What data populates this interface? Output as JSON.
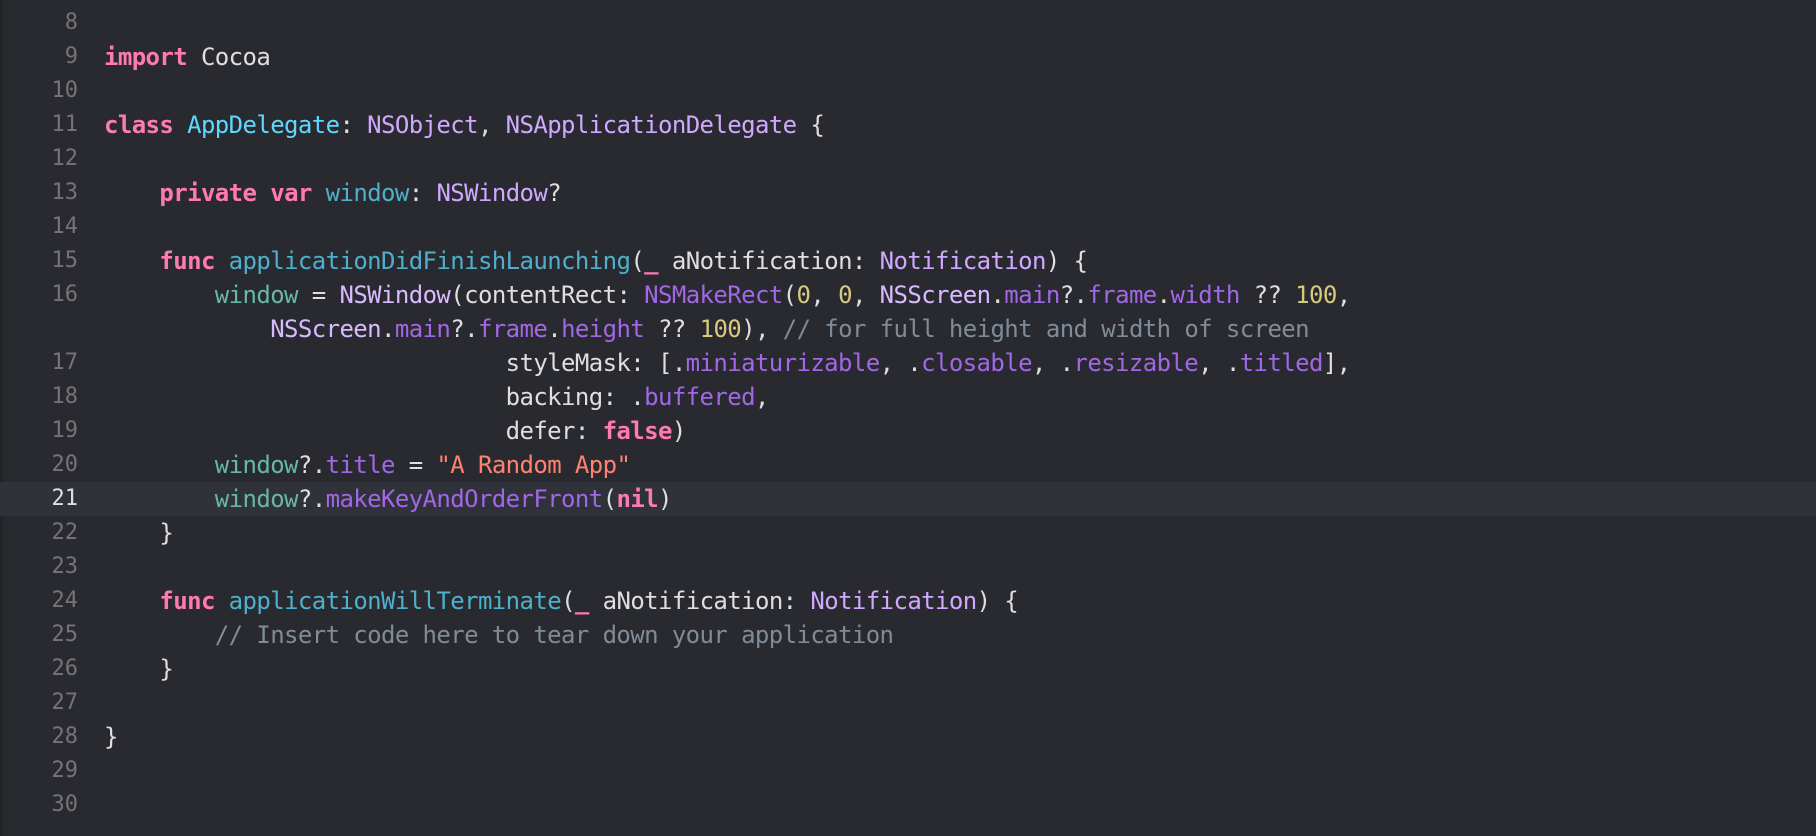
{
  "editor": {
    "lines": [
      {
        "number": "8",
        "current": false,
        "segments": []
      },
      {
        "number": "9",
        "current": false,
        "segments": [
          {
            "t": "import",
            "c": "kw"
          },
          {
            "t": " Cocoa",
            "c": "plain"
          }
        ]
      },
      {
        "number": "10",
        "current": false,
        "segments": []
      },
      {
        "number": "11",
        "current": false,
        "segments": [
          {
            "t": "class",
            "c": "kw"
          },
          {
            "t": " ",
            "c": "plain"
          },
          {
            "t": "AppDelegate",
            "c": "typeDecl"
          },
          {
            "t": ": ",
            "c": "plain"
          },
          {
            "t": "NSObject",
            "c": "type"
          },
          {
            "t": ", ",
            "c": "plain"
          },
          {
            "t": "NSApplicationDelegate",
            "c": "type"
          },
          {
            "t": " {",
            "c": "plain"
          }
        ]
      },
      {
        "number": "12",
        "current": false,
        "segments": []
      },
      {
        "number": "13",
        "current": false,
        "segments": [
          {
            "t": "    ",
            "c": "plain"
          },
          {
            "t": "private",
            "c": "kw"
          },
          {
            "t": " ",
            "c": "plain"
          },
          {
            "t": "var",
            "c": "kw"
          },
          {
            "t": " ",
            "c": "plain"
          },
          {
            "t": "window",
            "c": "func"
          },
          {
            "t": ": ",
            "c": "plain"
          },
          {
            "t": "NSWindow",
            "c": "type"
          },
          {
            "t": "?",
            "c": "plain"
          }
        ]
      },
      {
        "number": "14",
        "current": false,
        "segments": []
      },
      {
        "number": "15",
        "current": false,
        "segments": [
          {
            "t": "    ",
            "c": "plain"
          },
          {
            "t": "func",
            "c": "kw"
          },
          {
            "t": " ",
            "c": "plain"
          },
          {
            "t": "applicationDidFinishLaunching",
            "c": "func"
          },
          {
            "t": "(",
            "c": "plain"
          },
          {
            "t": "_",
            "c": "kw"
          },
          {
            "t": " aNotification: ",
            "c": "plain"
          },
          {
            "t": "Notification",
            "c": "type"
          },
          {
            "t": ") {",
            "c": "plain"
          }
        ]
      },
      {
        "number": "16",
        "current": false,
        "segments": [
          {
            "t": "        ",
            "c": "plain"
          },
          {
            "t": "window",
            "c": "var"
          },
          {
            "t": " = ",
            "c": "plain"
          },
          {
            "t": "NSWindow",
            "c": "typeSys"
          },
          {
            "t": "(contentRect: ",
            "c": "plain"
          },
          {
            "t": "NSMakeRect",
            "c": "member"
          },
          {
            "t": "(",
            "c": "plain"
          },
          {
            "t": "0",
            "c": "num"
          },
          {
            "t": ", ",
            "c": "plain"
          },
          {
            "t": "0",
            "c": "num"
          },
          {
            "t": ", ",
            "c": "plain"
          },
          {
            "t": "NSScreen",
            "c": "typeSys"
          },
          {
            "t": ".",
            "c": "plain"
          },
          {
            "t": "main",
            "c": "member"
          },
          {
            "t": "?.",
            "c": "plain"
          },
          {
            "t": "frame",
            "c": "member"
          },
          {
            "t": ".",
            "c": "plain"
          },
          {
            "t": "width",
            "c": "member"
          },
          {
            "t": " ?? ",
            "c": "plain"
          },
          {
            "t": "100",
            "c": "num"
          },
          {
            "t": ",",
            "c": "plain"
          }
        ]
      },
      {
        "number": "",
        "current": false,
        "segments": [
          {
            "t": "            ",
            "c": "plain"
          },
          {
            "t": "NSScreen",
            "c": "typeSys"
          },
          {
            "t": ".",
            "c": "plain"
          },
          {
            "t": "main",
            "c": "member"
          },
          {
            "t": "?.",
            "c": "plain"
          },
          {
            "t": "frame",
            "c": "member"
          },
          {
            "t": ".",
            "c": "plain"
          },
          {
            "t": "height",
            "c": "member"
          },
          {
            "t": " ?? ",
            "c": "plain"
          },
          {
            "t": "100",
            "c": "num"
          },
          {
            "t": "), ",
            "c": "plain"
          },
          {
            "t": "// for full height and width of screen",
            "c": "cmt"
          }
        ]
      },
      {
        "number": "17",
        "current": false,
        "segments": [
          {
            "t": "                             styleMask: [.",
            "c": "plain"
          },
          {
            "t": "miniaturizable",
            "c": "member"
          },
          {
            "t": ", .",
            "c": "plain"
          },
          {
            "t": "closable",
            "c": "member"
          },
          {
            "t": ", .",
            "c": "plain"
          },
          {
            "t": "resizable",
            "c": "member"
          },
          {
            "t": ", .",
            "c": "plain"
          },
          {
            "t": "titled",
            "c": "member"
          },
          {
            "t": "],",
            "c": "plain"
          }
        ]
      },
      {
        "number": "18",
        "current": false,
        "segments": [
          {
            "t": "                             backing: .",
            "c": "plain"
          },
          {
            "t": "buffered",
            "c": "member"
          },
          {
            "t": ",",
            "c": "plain"
          }
        ]
      },
      {
        "number": "19",
        "current": false,
        "segments": [
          {
            "t": "                             defer: ",
            "c": "plain"
          },
          {
            "t": "false",
            "c": "kw"
          },
          {
            "t": ")",
            "c": "plain"
          }
        ]
      },
      {
        "number": "20",
        "current": false,
        "segments": [
          {
            "t": "        ",
            "c": "plain"
          },
          {
            "t": "window",
            "c": "var"
          },
          {
            "t": "?.",
            "c": "plain"
          },
          {
            "t": "title",
            "c": "member"
          },
          {
            "t": " = ",
            "c": "plain"
          },
          {
            "t": "\"A Random App\"",
            "c": "str"
          }
        ]
      },
      {
        "number": "21",
        "current": true,
        "segments": [
          {
            "t": "        ",
            "c": "plain"
          },
          {
            "t": "window",
            "c": "var"
          },
          {
            "t": "?.",
            "c": "plain"
          },
          {
            "t": "makeKeyAndOrderFront",
            "c": "member"
          },
          {
            "t": "(",
            "c": "plain"
          },
          {
            "t": "nil",
            "c": "kw"
          },
          {
            "t": ")",
            "c": "plain"
          }
        ]
      },
      {
        "number": "22",
        "current": false,
        "segments": [
          {
            "t": "    }",
            "c": "plain"
          }
        ]
      },
      {
        "number": "23",
        "current": false,
        "segments": []
      },
      {
        "number": "24",
        "current": false,
        "segments": [
          {
            "t": "    ",
            "c": "plain"
          },
          {
            "t": "func",
            "c": "kw"
          },
          {
            "t": " ",
            "c": "plain"
          },
          {
            "t": "applicationWillTerminate",
            "c": "func"
          },
          {
            "t": "(",
            "c": "plain"
          },
          {
            "t": "_",
            "c": "kw"
          },
          {
            "t": " aNotification: ",
            "c": "plain"
          },
          {
            "t": "Notification",
            "c": "type"
          },
          {
            "t": ") {",
            "c": "plain"
          }
        ]
      },
      {
        "number": "25",
        "current": false,
        "segments": [
          {
            "t": "        ",
            "c": "plain"
          },
          {
            "t": "// Insert code here to tear down your application",
            "c": "cmt"
          }
        ]
      },
      {
        "number": "26",
        "current": false,
        "segments": [
          {
            "t": "    }",
            "c": "plain"
          }
        ]
      },
      {
        "number": "27",
        "current": false,
        "segments": []
      },
      {
        "number": "28",
        "current": false,
        "segments": [
          {
            "t": "}",
            "c": "plain"
          }
        ]
      },
      {
        "number": "29",
        "current": false,
        "segments": []
      },
      {
        "number": "30",
        "current": false,
        "segments": []
      }
    ]
  }
}
